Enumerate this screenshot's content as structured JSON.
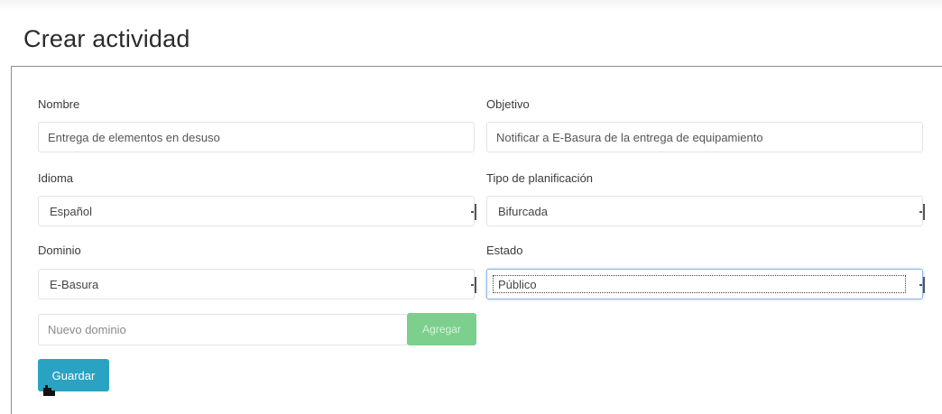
{
  "page": {
    "title": "Crear actividad"
  },
  "form": {
    "nombre": {
      "label": "Nombre",
      "value": "Entrega de elementos en desuso"
    },
    "objetivo": {
      "label": "Objetivo",
      "value": "Notificar a E-Basura de la entrega de equipamiento"
    },
    "idioma": {
      "label": "Idioma",
      "selected": "Español"
    },
    "tipo_planificacion": {
      "label": "Tipo de planificación",
      "selected": "Bifurcada"
    },
    "dominio": {
      "label": "Dominio",
      "selected": "E-Basura"
    },
    "estado": {
      "label": "Estado",
      "selected": "Público"
    },
    "nuevo_dominio": {
      "placeholder": "Nuevo dominio"
    },
    "agregar_label": "Agregar",
    "guardar_label": "Guardar"
  },
  "colors": {
    "guardar": "#2aa3c2",
    "agregar": "#7ccf8c",
    "focus": "#8fb3e6"
  },
  "icons": {
    "cursor": "hand-pointer-icon",
    "select_arrow": "select-arrow-icon"
  }
}
